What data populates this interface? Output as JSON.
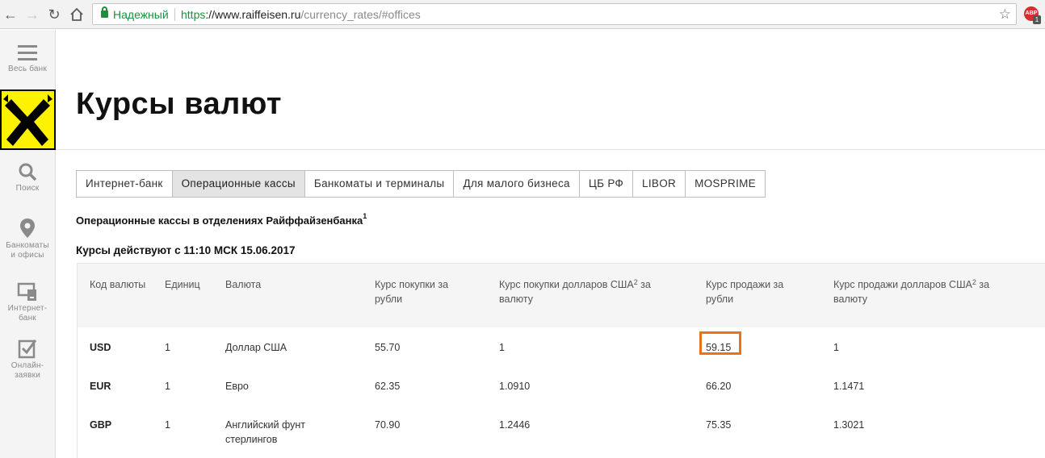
{
  "browser": {
    "secure_label": "Надежный",
    "url_scheme": "https",
    "url_host": "://www.raiffeisen.ru",
    "url_path": "/currency_rates/#offices",
    "extension_badge": "ABP",
    "extension_count": "1"
  },
  "sidebar": {
    "menu_label": "Весь банк",
    "items": [
      {
        "label": "Поиск",
        "icon": "search-icon"
      },
      {
        "label": "Банкоматы\nи офисы",
        "icon": "location-pin-icon"
      },
      {
        "label": "Интернет-\nбанк",
        "icon": "internet-bank-icon"
      },
      {
        "label": "Онлайн-\nзаявки",
        "icon": "checkbox-icon"
      }
    ]
  },
  "page": {
    "title": "Курсы валют",
    "tabs": [
      "Интернет-банк",
      "Операционные кассы",
      "Банкоматы и терминалы",
      "Для малого бизнеса",
      "ЦБ РФ",
      "LIBOR",
      "MOSPRIME"
    ],
    "active_tab": 1,
    "subtitle": "Операционные кассы в отделениях Райффайзенбанка",
    "subtitle_sup": "1",
    "valid_from": "Курсы действуют с 11:10 МСК 15.06.2017"
  },
  "table": {
    "headers": {
      "code": "Код валюты",
      "units": "Единиц",
      "currency": "Валюта",
      "buy_rub": "Курс покупки за рубли",
      "buy_usd": "Курс покупки долларов США",
      "buy_usd_tail": " за валюту",
      "sell_rub": "Курс продажи за рубли",
      "sell_usd": "Курс продажи долларов США",
      "sell_usd_tail": " за валюту",
      "sup": "2"
    },
    "rows": [
      {
        "code": "USD",
        "units": "1",
        "currency": "Доллар США",
        "buy_rub": "55.70",
        "buy_usd": "1",
        "sell_rub": "59.15",
        "sell_usd": "1"
      },
      {
        "code": "EUR",
        "units": "1",
        "currency": "Евро",
        "buy_rub": "62.35",
        "buy_usd": "1.0910",
        "sell_rub": "66.20",
        "sell_usd": "1.1471"
      },
      {
        "code": "GBP",
        "units": "1",
        "currency": "Английский фунт стерлингов",
        "buy_rub": "70.90",
        "buy_usd": "1.2446",
        "sell_rub": "75.35",
        "sell_usd": "1.3021"
      }
    ]
  },
  "colors": {
    "logo_yellow": "#fff200",
    "highlight": "#e8731a",
    "secure_green": "#1e8e3e"
  }
}
